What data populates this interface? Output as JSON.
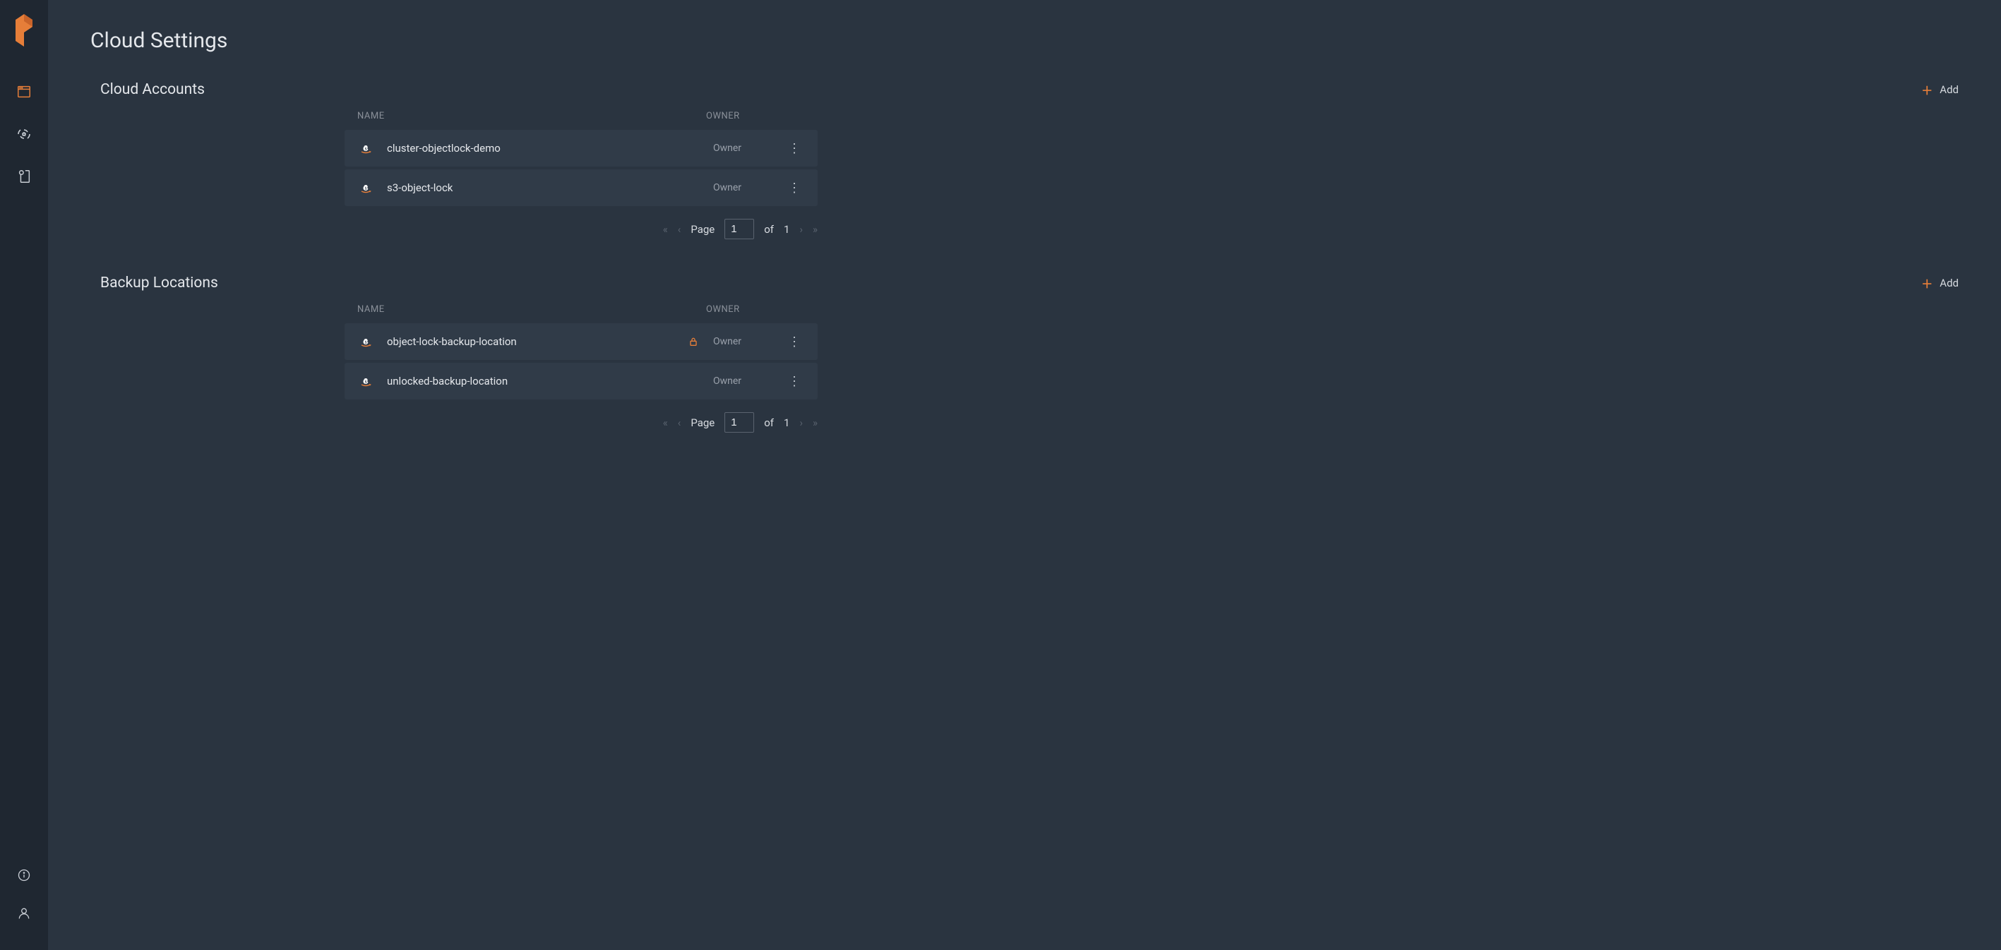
{
  "page": {
    "title": "Cloud Settings"
  },
  "addLabel": "Add",
  "columns": {
    "name": "NAME",
    "owner": "OWNER"
  },
  "sections": {
    "cloudAccounts": {
      "title": "Cloud Accounts",
      "rows": [
        {
          "name": "cluster-objectlock-demo",
          "owner": "Owner",
          "locked": false
        },
        {
          "name": "s3-object-lock",
          "owner": "Owner",
          "locked": false
        }
      ],
      "pagination": {
        "pageLabel": "Page",
        "current": "1",
        "ofLabel": "of",
        "total": "1"
      }
    },
    "backupLocations": {
      "title": "Backup Locations",
      "rows": [
        {
          "name": "object-lock-backup-location",
          "owner": "Owner",
          "locked": true
        },
        {
          "name": "unlocked-backup-location",
          "owner": "Owner",
          "locked": false
        }
      ],
      "pagination": {
        "pageLabel": "Page",
        "current": "1",
        "ofLabel": "of",
        "total": "1"
      }
    }
  },
  "colors": {
    "accent": "#e67e39",
    "bg": "#2a3440",
    "sidebar": "#1f2731",
    "row": "#303b48"
  }
}
